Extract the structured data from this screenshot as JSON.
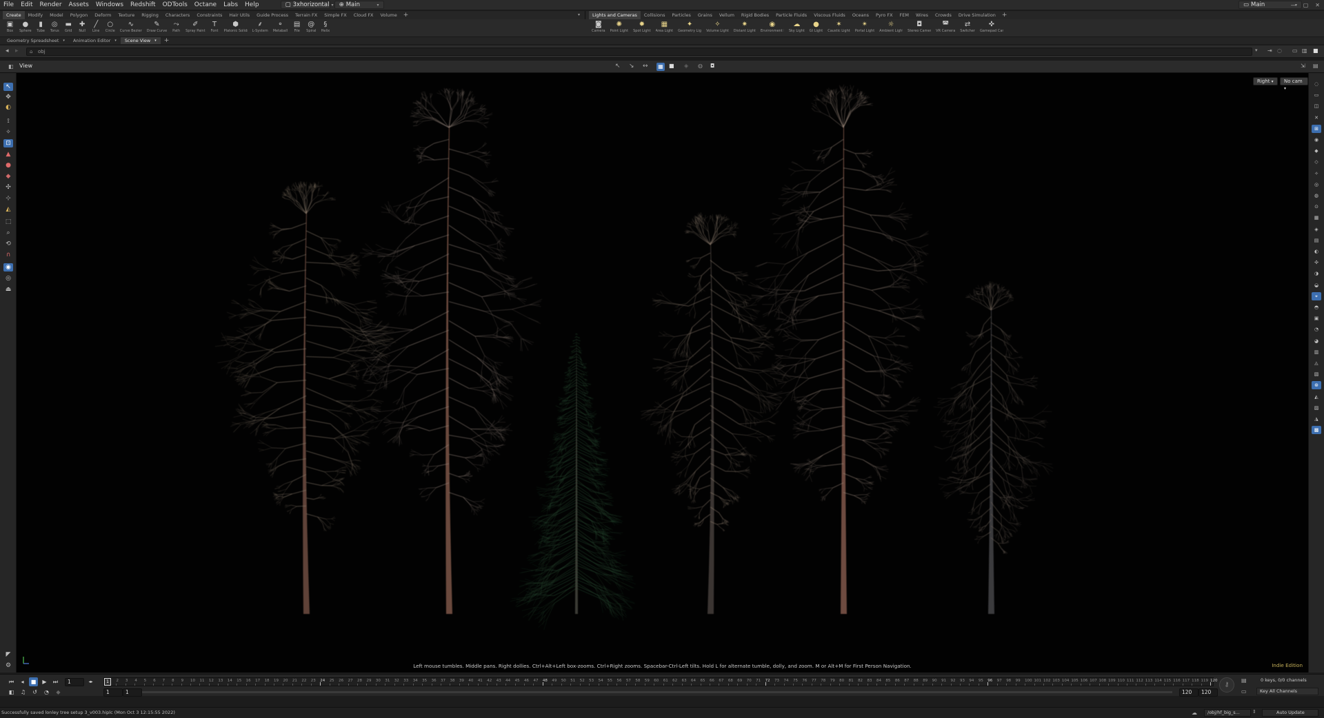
{
  "menubar": {
    "items": [
      "File",
      "Edit",
      "Render",
      "Assets",
      "Windows",
      "Redshift",
      "ODTools",
      "Octane",
      "Labs",
      "Help"
    ],
    "desktop": "3xhorizontal",
    "network": "Main",
    "right_desktop": "Main"
  },
  "shelf_tabs_left": [
    "Create",
    "Modify",
    "Model",
    "Polygon",
    "Deform",
    "Texture",
    "Rigging",
    "Characters",
    "Constraints",
    "Hair Utils",
    "Guide Process",
    "Terrain FX",
    "Simple FX",
    "Cloud FX",
    "Volume"
  ],
  "shelf_tabs_right": [
    "Lights and Cameras",
    "Collisions",
    "Particles",
    "Grains",
    "Vellum",
    "Rigid Bodies",
    "Particle Fluids",
    "Viscous Fluids",
    "Oceans",
    "Pyro FX",
    "FEM",
    "Wires",
    "Crowds",
    "Drive Simulation"
  ],
  "tools_left": [
    {
      "label": "Box",
      "icon": "box-icon",
      "glyph": "▣"
    },
    {
      "label": "Sphere",
      "icon": "sphere-icon",
      "glyph": "●"
    },
    {
      "label": "Tube",
      "icon": "tube-icon",
      "glyph": "▮"
    },
    {
      "label": "Torus",
      "icon": "torus-icon",
      "glyph": "◎"
    },
    {
      "label": "Grid",
      "icon": "grid-icon",
      "glyph": "▬"
    },
    {
      "label": "Null",
      "icon": "null-icon",
      "glyph": "✚"
    },
    {
      "label": "Line",
      "icon": "line-icon",
      "glyph": "╱"
    },
    {
      "label": "Circle",
      "icon": "circle-icon",
      "glyph": "○"
    },
    {
      "label": "Curve Bezier",
      "icon": "curve-bezier-icon",
      "glyph": "∿"
    },
    {
      "label": "Draw Curve",
      "icon": "draw-curve-icon",
      "glyph": "✎"
    },
    {
      "label": "Path",
      "icon": "path-icon",
      "glyph": "⤳"
    },
    {
      "label": "Spray Paint",
      "icon": "spray-paint-icon",
      "glyph": "✐"
    },
    {
      "label": "Font",
      "icon": "font-icon",
      "glyph": "T"
    },
    {
      "label": "Platonic Solids",
      "icon": "platonic-solids-icon",
      "glyph": "⬢"
    },
    {
      "label": "L-System",
      "icon": "l-system-icon",
      "glyph": "⸙"
    },
    {
      "label": "Metaball",
      "icon": "metaball-icon",
      "glyph": "⚬"
    },
    {
      "label": "File",
      "icon": "file-icon",
      "glyph": "▤"
    },
    {
      "label": "Spiral",
      "icon": "spiral-icon",
      "glyph": "@"
    },
    {
      "label": "Helix",
      "icon": "helix-icon",
      "glyph": "§"
    }
  ],
  "tools_right": [
    {
      "label": "Camera",
      "icon": "camera-icon",
      "glyph": "◙"
    },
    {
      "label": "Point Light",
      "icon": "point-light-icon",
      "glyph": "✺"
    },
    {
      "label": "Spot Light",
      "icon": "spot-light-icon",
      "glyph": "✹"
    },
    {
      "label": "Area Light",
      "icon": "area-light-icon",
      "glyph": "▦"
    },
    {
      "label": "Geometry Light",
      "icon": "geometry-light-icon",
      "glyph": "✦"
    },
    {
      "label": "Volume Light",
      "icon": "volume-light-icon",
      "glyph": "✧"
    },
    {
      "label": "Distant Light",
      "icon": "distant-light-icon",
      "glyph": "✷"
    },
    {
      "label": "Environment Light",
      "icon": "environment-light-icon",
      "glyph": "◉"
    },
    {
      "label": "Sky Light",
      "icon": "sky-light-icon",
      "glyph": "☁"
    },
    {
      "label": "GI Light",
      "icon": "gi-light-icon",
      "glyph": "●"
    },
    {
      "label": "Caustic Light",
      "icon": "caustic-light-icon",
      "glyph": "✶"
    },
    {
      "label": "Portal Light",
      "icon": "portal-light-icon",
      "glyph": "✴"
    },
    {
      "label": "Ambient Light",
      "icon": "ambient-light-icon",
      "glyph": "☼"
    },
    {
      "label": "Stereo Camera",
      "icon": "stereo-camera-icon",
      "glyph": "◘"
    },
    {
      "label": "VR Camera",
      "icon": "vr-camera-icon",
      "glyph": "◚"
    },
    {
      "label": "Switcher",
      "icon": "switcher-icon",
      "glyph": "⇄"
    },
    {
      "label": "Gamepad Camera",
      "icon": "gamepad-camera-icon",
      "glyph": "✜"
    }
  ],
  "pane_tabs": [
    "Geometry Spreadsheet",
    "Animation Editor",
    "Scene View"
  ],
  "path": "obj",
  "view": {
    "label": "View",
    "hint": "Left mouse tumbles. Middle pans. Right dollies. Ctrl+Alt+Left box-zooms. Ctrl+Right zooms. Spacebar-Ctrl-Left tilts. Hold L for alternate tumble, dolly, and zoom.    M or Alt+M for First Person Navigation.",
    "camera_view": "Right",
    "camera": "No cam",
    "edition": "Indie Edition"
  },
  "timeline": {
    "current_frame": "1",
    "start": "1",
    "start2": "1",
    "end": "120",
    "end2": "120",
    "ticks": [
      "1",
      "2",
      "3",
      "4",
      "5",
      "6",
      "7",
      "8",
      "9",
      "10",
      "11",
      "12",
      "13",
      "14",
      "15",
      "16",
      "17",
      "18",
      "19",
      "20",
      "21",
      "22",
      "23",
      "24",
      "25",
      "26",
      "27",
      "28",
      "29",
      "30",
      "31",
      "32",
      "33",
      "34",
      "35",
      "36",
      "37",
      "38",
      "39",
      "40",
      "41",
      "42",
      "43",
      "44",
      "45",
      "46",
      "47",
      "48",
      "49",
      "50",
      "51",
      "52",
      "53",
      "54",
      "55",
      "56",
      "57",
      "58",
      "59",
      "60",
      "61",
      "62",
      "63",
      "64",
      "65",
      "66",
      "67",
      "68",
      "69",
      "70",
      "71",
      "72",
      "73",
      "74",
      "75",
      "76",
      "77",
      "78",
      "79",
      "80",
      "81",
      "82",
      "83",
      "84",
      "85",
      "86",
      "87",
      "88",
      "89",
      "90",
      "91",
      "92",
      "93",
      "94",
      "95",
      "96",
      "97",
      "98",
      "99",
      "100",
      "101",
      "102",
      "103",
      "104",
      "105",
      "106",
      "107",
      "108",
      "109",
      "110",
      "111",
      "112",
      "113",
      "114",
      "115",
      "116",
      "117",
      "118",
      "119",
      "120"
    ],
    "major_ticks": [
      "24",
      "48",
      "72",
      "96",
      "120"
    ],
    "keys_info": "0 keys, 0/0 channels",
    "key_all": "Key All Channels"
  },
  "status": {
    "message": "Successfully saved lonley tree setup 3_v003.hiplc (Mon Oct 3 12:15:55 2022)",
    "node_path": "/obj/hf_big_s...",
    "update_mode": "Auto Update"
  },
  "colors": {
    "accent": "#3d6fb0",
    "bark": "#6b4a3c",
    "needles": "#2f5a3a",
    "edition": "#c6b15a"
  }
}
